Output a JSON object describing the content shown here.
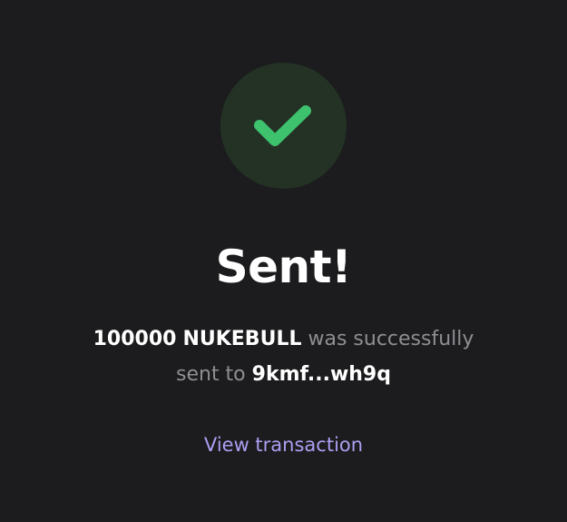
{
  "status": {
    "icon": "checkmark-icon",
    "circle_color": "#233225",
    "check_color": "#3ec26d"
  },
  "title": "Sent!",
  "message": {
    "amount": "100000",
    "token": "NUKEBULL",
    "middle_text": " was successfully sent to ",
    "recipient": "9kmf...wh9q"
  },
  "link": {
    "label": "View transaction",
    "color": "#ab9ff2"
  }
}
